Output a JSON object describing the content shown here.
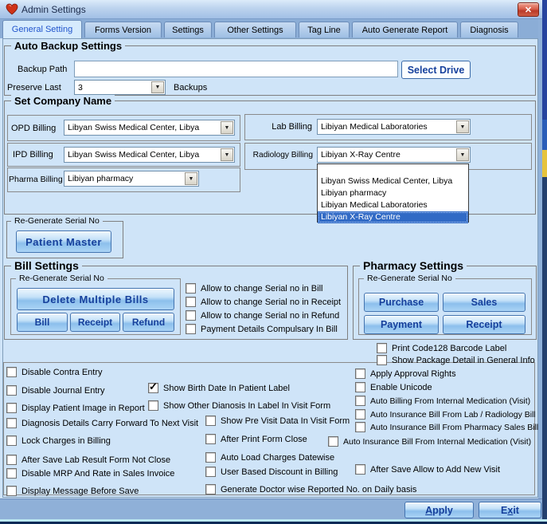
{
  "window": {
    "title": "Admin Settings",
    "close_glyph": "✕"
  },
  "tabs": [
    {
      "label": "General Setting",
      "active": true
    },
    {
      "label": "Forms Version",
      "active": false
    },
    {
      "label": "Settings",
      "active": false
    },
    {
      "label": "Other Settings",
      "active": false
    },
    {
      "label": "Tag Line",
      "active": false
    },
    {
      "label": "Auto Generate Report",
      "active": false
    },
    {
      "label": "Diagnosis",
      "active": false
    }
  ],
  "auto_backup": {
    "title": "Auto Backup Settings",
    "backup_path_label": "Backup Path",
    "backup_path_value": "",
    "select_drive_button": "Select Drive",
    "preserve_last_label": "Preserve Last",
    "preserve_last_value": "3",
    "backups_label": "Backups"
  },
  "company": {
    "title": "Set Company Name",
    "opd": {
      "label": "OPD Billing",
      "value": "Libyan Swiss Medical Center, Libya"
    },
    "ipd": {
      "label": "IPD Billing",
      "value": "Libyan Swiss Medical Center, Libya"
    },
    "pharma": {
      "label": "Pharma Billing",
      "value": "Libiyan pharmacy"
    },
    "lab": {
      "label": "Lab Billing",
      "value": "Libiyan Medical Laboratories"
    },
    "radiology": {
      "label": "Radiology Billing",
      "value": "Libiyan X-Ray Centre"
    },
    "dropdown": {
      "items": [
        "",
        "Libyan Swiss Medical Center, Libya",
        "Libiyan pharmacy",
        "Libiyan Medical Laboratories",
        "Libiyan X-Ray Centre"
      ],
      "selected": "Libiyan X-Ray Centre",
      "selected_index": 4
    }
  },
  "regen_patient": {
    "title": "Re-Generate Serial No",
    "patient_master_button": "Patient Master"
  },
  "bill": {
    "title": "Bill Settings",
    "regen_title": "Re-Generate Serial No",
    "delete_button": "Delete Multiple Bills",
    "bill_button": "Bill",
    "receipt_button": "Receipt",
    "refund_button": "Refund",
    "checks": [
      {
        "label": "Allow to change Serial no in Bill",
        "checked": false
      },
      {
        "label": "Allow to change Serial no in Receipt",
        "checked": false
      },
      {
        "label": "Allow to change Serial no in Refund",
        "checked": false
      },
      {
        "label": "Payment Details Compulsary In Bill",
        "checked": false
      }
    ]
  },
  "pharmacy": {
    "title": "Pharmacy Settings",
    "regen_title": "Re-Generate Serial No",
    "purchase_button": "Purchase",
    "sales_button": "Sales",
    "payment_button": "Payment",
    "receipt_button": "Receipt"
  },
  "options": [
    {
      "label": "Print Code128 Barcode Label",
      "checked": false
    },
    {
      "label": "Show Package Detail in General Info",
      "checked": false
    },
    {
      "label": "Disable Contra Entry",
      "checked": false
    },
    {
      "label": "Disable Journal Entry",
      "checked": false
    },
    {
      "label": "Display Patient Image in Report",
      "checked": false
    },
    {
      "label": "Diagnosis Details Carry Forward To Next Visit",
      "checked": false
    },
    {
      "label": "Lock Charges in Billing",
      "checked": false
    },
    {
      "label": "After Save Lab Result Form Not Close",
      "checked": false
    },
    {
      "label": "Disable MRP And Rate in Sales Invoice",
      "checked": false
    },
    {
      "label": "Display Message Before Save",
      "checked": false
    },
    {
      "label": "Show Birth Date In Patient Label",
      "checked": true
    },
    {
      "label": "Show Other Dianosis In Label In Visit Form",
      "checked": false
    },
    {
      "label": "Show Pre Visit Data In Visit Form",
      "checked": false
    },
    {
      "label": "After Print Form Close",
      "checked": false
    },
    {
      "label": "Auto Load Charges Datewise",
      "checked": false
    },
    {
      "label": "User Based Discount in Billing",
      "checked": false
    },
    {
      "label": "Generate Doctor wise Reported No. on Daily basis",
      "checked": false
    },
    {
      "label": "Apply Approval Rights",
      "checked": false
    },
    {
      "label": "Enable Unicode",
      "checked": false
    },
    {
      "label": "Auto Billing From Internal Medication (Visit)",
      "checked": false
    },
    {
      "label": "Auto Insurance Bill From Lab / Radiology Bill",
      "checked": false
    },
    {
      "label": "Auto Insurance Bill From Pharmacy Sales Bill",
      "checked": false
    },
    {
      "label": "Auto Insurance Bill From Internal Medication (Visit)",
      "checked": false
    },
    {
      "label": "After Save Allow to Add New Visit",
      "checked": false
    }
  ],
  "footer": {
    "apply": {
      "pre": "",
      "underline": "A",
      "post": "pply"
    },
    "exit": {
      "pre": "E",
      "underline": "x",
      "post": "it"
    }
  },
  "colors": {
    "panel_bg": "#cfe4f8",
    "selection_blue": "#316ac5",
    "button_text_navy": "#16409c",
    "close_red": "#b93a28",
    "active_tab_text": "#2255cc"
  }
}
